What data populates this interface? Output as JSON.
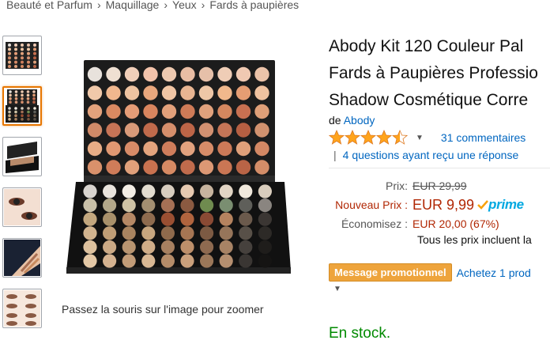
{
  "breadcrumb": {
    "items": [
      "Beauté et Parfum",
      "Maquillage",
      "Yeux",
      "Fards à paupières"
    ],
    "separator": "›"
  },
  "gallery": {
    "thumbnails": [
      "palette-top-view",
      "palette-open",
      "palette-side-angle",
      "eye-makeup-model",
      "arm-swatches",
      "eye-tutorial-steps"
    ],
    "active_index": 1,
    "zoom_hint": "Passez la souris sur l'image pour zoomer"
  },
  "product": {
    "title_lines": [
      "Abody Kit 120 Couleur Pal",
      "Fards à Paupières Professio",
      "Shadow Cosmétique Corre"
    ],
    "brand_prefix": "de",
    "brand": "Abody",
    "rating": 4.5,
    "reviews": "31 commentaires",
    "questions_separator": "|",
    "questions": "4 questions ayant reçu une réponse"
  },
  "price": {
    "list_label": "Prix:",
    "list_value": "EUR 29,99",
    "new_label": "Nouveau Prix :",
    "new_value": "EUR 9,99",
    "prime_label": "prime",
    "savings_label": "Économisez :",
    "savings_value": "EUR 20,00 (67%)",
    "tax_note": "Tous les prix incluent la"
  },
  "promo": {
    "badge": "Message promotionnel",
    "link": "Achetez 1 prod"
  },
  "stock": "En stock.",
  "colors": {
    "link": "#0066c0",
    "price_red": "#b12704",
    "stock_green": "#008a00",
    "promo_orange": "#eea43c",
    "prime_blue": "#00a8e1",
    "star": "#ffa41c"
  }
}
